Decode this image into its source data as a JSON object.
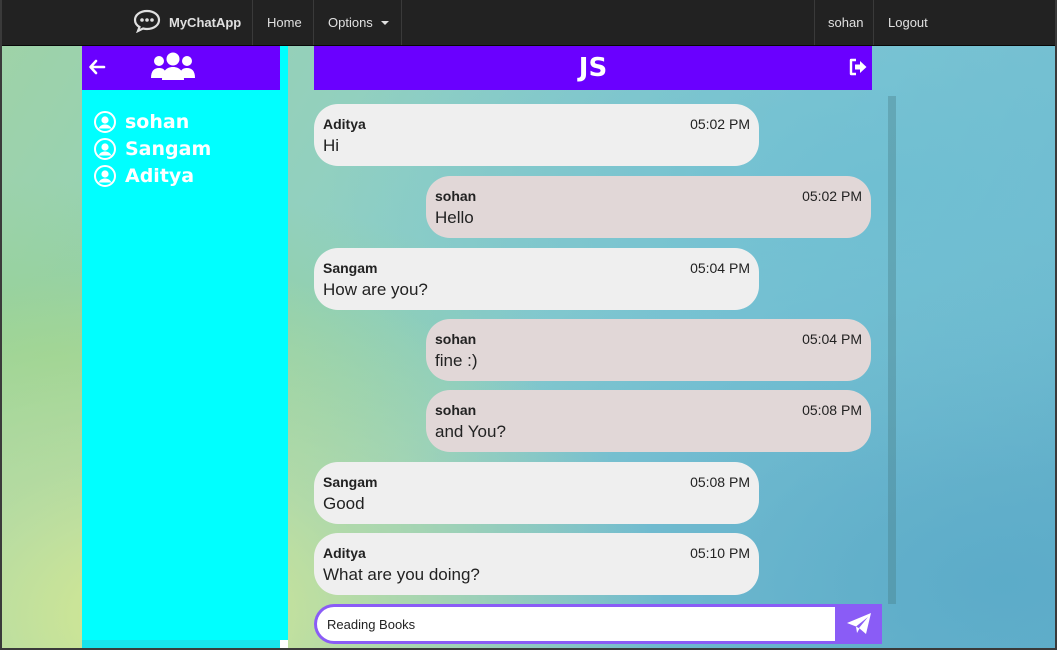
{
  "navbar": {
    "brand": "MyChatApp",
    "home": "Home",
    "options": "Options",
    "user": "sohan",
    "logout": "Logout"
  },
  "sidebar": {
    "users": [
      "sohan",
      "Sangam",
      "Aditya"
    ]
  },
  "chat": {
    "title": "JS",
    "messages": [
      {
        "sender": "Aditya",
        "time": "05:02 PM",
        "text": "Hi",
        "self": false
      },
      {
        "sender": "sohan",
        "time": "05:02 PM",
        "text": "Hello",
        "self": true
      },
      {
        "sender": "Sangam",
        "time": "05:04 PM",
        "text": "How are you?",
        "self": false
      },
      {
        "sender": "sohan",
        "time": "05:04 PM",
        "text": "fine :)",
        "self": true
      },
      {
        "sender": "sohan",
        "time": "05:08 PM",
        "text": "and You?",
        "self": true
      },
      {
        "sender": "Sangam",
        "time": "05:08 PM",
        "text": "Good",
        "self": false
      },
      {
        "sender": "Aditya",
        "time": "05:10 PM",
        "text": "What are you doing?",
        "self": false
      }
    ],
    "input_value": "Reading Books"
  },
  "colors": {
    "navbar": "#222222",
    "header": "#6a00ff",
    "sidebar": "#00ffff",
    "bubble_other": "#efefef",
    "bubble_self": "#e1d7d7",
    "send": "#8a5cf6"
  },
  "icons": {
    "brand": "chat-bubble-icon",
    "back": "arrow-left-icon",
    "users": "users-group-icon",
    "user": "user-circle-icon",
    "leave": "sign-out-icon",
    "send": "paper-plane-icon"
  }
}
